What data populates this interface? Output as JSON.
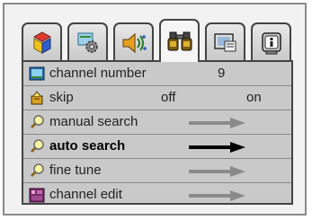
{
  "tabs": [
    {
      "icon": "picture-color-blocks-icon"
    },
    {
      "icon": "settings-gear-icon"
    },
    {
      "icon": "sound-speaker-icon"
    },
    {
      "icon": "binoculars-icon",
      "active": true
    },
    {
      "icon": "screen-display-icon"
    },
    {
      "icon": "info-icon"
    }
  ],
  "rows": [
    {
      "label": "channel number",
      "value": "9",
      "icon": "channel-tv-icon"
    },
    {
      "label": "skip",
      "option_off": "off",
      "option_on": "on",
      "icon": "skip-icon"
    },
    {
      "label": "manual search",
      "icon": "search-magnifier-icon"
    },
    {
      "label": "auto search",
      "icon": "search-magnifier-icon",
      "selected": true
    },
    {
      "label": "fine tune",
      "icon": "search-magnifier-icon"
    },
    {
      "label": "channel edit",
      "icon": "channel-edit-icon"
    }
  ],
  "colors": {
    "arrow": "#8a8a8a",
    "arrow_selected": "#000000",
    "panel": "#c9c9c9"
  }
}
